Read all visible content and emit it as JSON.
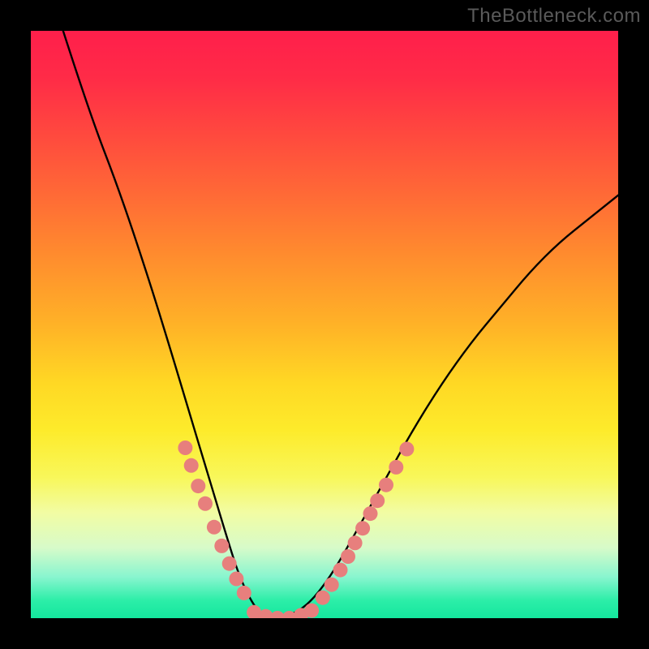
{
  "watermark": "TheBottleneck.com",
  "chart_data": {
    "type": "line",
    "title": "",
    "xlabel": "",
    "ylabel": "",
    "xlim": [
      0,
      1
    ],
    "ylim": [
      0,
      1
    ],
    "grid": false,
    "legend": false,
    "series": [
      {
        "name": "curve",
        "color": "#000000",
        "x": [
          0.055,
          0.1,
          0.15,
          0.2,
          0.24,
          0.27,
          0.3,
          0.33,
          0.355,
          0.38,
          0.4,
          0.43,
          0.47,
          0.51,
          0.55,
          0.6,
          0.65,
          0.7,
          0.75,
          0.8,
          0.85,
          0.9,
          0.95,
          1.0
        ],
        "y": [
          1.0,
          0.86,
          0.73,
          0.58,
          0.45,
          0.35,
          0.25,
          0.15,
          0.07,
          0.02,
          0.0,
          0.0,
          0.02,
          0.07,
          0.14,
          0.23,
          0.32,
          0.4,
          0.47,
          0.53,
          0.59,
          0.64,
          0.68,
          0.72
        ]
      }
    ],
    "annotations": [
      {
        "name": "pink-dots-left",
        "color": "#e77f7d",
        "points": [
          {
            "x": 0.263,
            "y": 0.29
          },
          {
            "x": 0.273,
            "y": 0.26
          },
          {
            "x": 0.285,
            "y": 0.225
          },
          {
            "x": 0.297,
            "y": 0.195
          },
          {
            "x": 0.312,
            "y": 0.155
          },
          {
            "x": 0.325,
            "y": 0.123
          },
          {
            "x": 0.338,
            "y": 0.093
          },
          {
            "x": 0.35,
            "y": 0.067
          },
          {
            "x": 0.363,
            "y": 0.043
          }
        ]
      },
      {
        "name": "pink-dots-bottom",
        "points": [
          {
            "x": 0.38,
            "y": 0.01
          },
          {
            "x": 0.4,
            "y": 0.003
          },
          {
            "x": 0.42,
            "y": 0.0
          },
          {
            "x": 0.44,
            "y": 0.0
          },
          {
            "x": 0.46,
            "y": 0.005
          },
          {
            "x": 0.478,
            "y": 0.013
          }
        ]
      },
      {
        "name": "pink-dots-right",
        "points": [
          {
            "x": 0.497,
            "y": 0.035
          },
          {
            "x": 0.512,
            "y": 0.057
          },
          {
            "x": 0.527,
            "y": 0.082
          },
          {
            "x": 0.54,
            "y": 0.105
          },
          {
            "x": 0.552,
            "y": 0.128
          },
          {
            "x": 0.565,
            "y": 0.153
          },
          {
            "x": 0.578,
            "y": 0.178
          },
          {
            "x": 0.59,
            "y": 0.2
          },
          {
            "x": 0.605,
            "y": 0.227
          },
          {
            "x": 0.622,
            "y": 0.257
          },
          {
            "x": 0.64,
            "y": 0.288
          }
        ]
      }
    ]
  }
}
